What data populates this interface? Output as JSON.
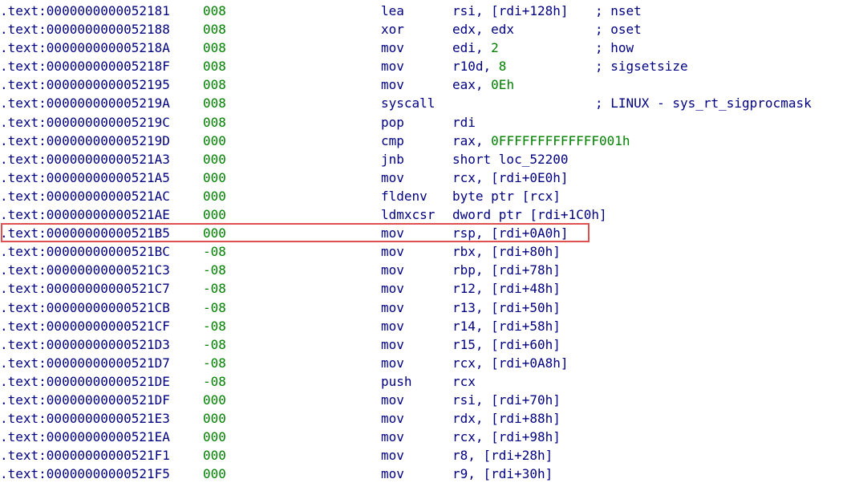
{
  "listing": {
    "highlight_color": "#e05050",
    "colors": {
      "text": "#000080",
      "stack_pointer": "#008000",
      "immediate": "#008000"
    },
    "highlighted_line_index": 12,
    "lines": [
      {
        "address": ".text:0000000000052181",
        "sp": "008",
        "mnemonic": "lea",
        "operands": [
          {
            "text": "rsi, [rdi+128h]",
            "kind": "reg"
          }
        ],
        "comment": "; nset"
      },
      {
        "address": ".text:0000000000052188",
        "sp": "008",
        "mnemonic": "xor",
        "operands": [
          {
            "text": "edx, edx",
            "kind": "reg"
          }
        ],
        "comment": "; oset"
      },
      {
        "address": ".text:000000000005218A",
        "sp": "008",
        "mnemonic": "mov",
        "operands": [
          {
            "text": "edi, ",
            "kind": "reg"
          },
          {
            "text": "2",
            "kind": "num"
          }
        ],
        "comment": "; how"
      },
      {
        "address": ".text:000000000005218F",
        "sp": "008",
        "mnemonic": "mov",
        "operands": [
          {
            "text": "r10d, ",
            "kind": "reg"
          },
          {
            "text": "8",
            "kind": "num"
          }
        ],
        "comment": "; sigsetsize"
      },
      {
        "address": ".text:0000000000052195",
        "sp": "008",
        "mnemonic": "mov",
        "operands": [
          {
            "text": "eax, ",
            "kind": "reg"
          },
          {
            "text": "0Eh",
            "kind": "num"
          }
        ],
        "comment": ""
      },
      {
        "address": ".text:000000000005219A",
        "sp": "008",
        "mnemonic": "syscall",
        "operands": [],
        "comment": "; LINUX - sys_rt_sigprocmask"
      },
      {
        "address": ".text:000000000005219C",
        "sp": "008",
        "mnemonic": "pop",
        "operands": [
          {
            "text": "rdi",
            "kind": "reg"
          }
        ],
        "comment": ""
      },
      {
        "address": ".text:000000000005219D",
        "sp": "000",
        "mnemonic": "cmp",
        "operands": [
          {
            "text": "rax, ",
            "kind": "reg"
          },
          {
            "text": "0FFFFFFFFFFFFF001h",
            "kind": "num"
          }
        ],
        "comment": ""
      },
      {
        "address": ".text:00000000000521A3",
        "sp": "000",
        "mnemonic": "jnb",
        "operands": [
          {
            "text": "short loc_52200",
            "kind": "reg"
          }
        ],
        "comment": ""
      },
      {
        "address": ".text:00000000000521A5",
        "sp": "000",
        "mnemonic": "mov",
        "operands": [
          {
            "text": "rcx, [rdi+0E0h]",
            "kind": "reg"
          }
        ],
        "comment": ""
      },
      {
        "address": ".text:00000000000521AC",
        "sp": "000",
        "mnemonic": "fldenv",
        "operands": [
          {
            "text": "byte ptr [rcx]",
            "kind": "reg"
          }
        ],
        "comment": ""
      },
      {
        "address": ".text:00000000000521AE",
        "sp": "000",
        "mnemonic": "ldmxcsr",
        "operands": [
          {
            "text": "dword ptr [rdi+1C0h]",
            "kind": "reg"
          }
        ],
        "comment": ""
      },
      {
        "address": ".text:00000000000521B5",
        "sp": "000",
        "mnemonic": "mov",
        "operands": [
          {
            "text": "rsp, [rdi+0A0h]",
            "kind": "reg"
          }
        ],
        "comment": ""
      },
      {
        "address": ".text:00000000000521BC",
        "sp": "-08",
        "mnemonic": "mov",
        "operands": [
          {
            "text": "rbx, [rdi+80h]",
            "kind": "reg"
          }
        ],
        "comment": ""
      },
      {
        "address": ".text:00000000000521C3",
        "sp": "-08",
        "mnemonic": "mov",
        "operands": [
          {
            "text": "rbp, [rdi+78h]",
            "kind": "reg"
          }
        ],
        "comment": ""
      },
      {
        "address": ".text:00000000000521C7",
        "sp": "-08",
        "mnemonic": "mov",
        "operands": [
          {
            "text": "r12, [rdi+48h]",
            "kind": "reg"
          }
        ],
        "comment": ""
      },
      {
        "address": ".text:00000000000521CB",
        "sp": "-08",
        "mnemonic": "mov",
        "operands": [
          {
            "text": "r13, [rdi+50h]",
            "kind": "reg"
          }
        ],
        "comment": ""
      },
      {
        "address": ".text:00000000000521CF",
        "sp": "-08",
        "mnemonic": "mov",
        "operands": [
          {
            "text": "r14, [rdi+58h]",
            "kind": "reg"
          }
        ],
        "comment": ""
      },
      {
        "address": ".text:00000000000521D3",
        "sp": "-08",
        "mnemonic": "mov",
        "operands": [
          {
            "text": "r15, [rdi+60h]",
            "kind": "reg"
          }
        ],
        "comment": ""
      },
      {
        "address": ".text:00000000000521D7",
        "sp": "-08",
        "mnemonic": "mov",
        "operands": [
          {
            "text": "rcx, [rdi+0A8h]",
            "kind": "reg"
          }
        ],
        "comment": ""
      },
      {
        "address": ".text:00000000000521DE",
        "sp": "-08",
        "mnemonic": "push",
        "operands": [
          {
            "text": "rcx",
            "kind": "reg"
          }
        ],
        "comment": ""
      },
      {
        "address": ".text:00000000000521DF",
        "sp": "000",
        "mnemonic": "mov",
        "operands": [
          {
            "text": "rsi, [rdi+70h]",
            "kind": "reg"
          }
        ],
        "comment": ""
      },
      {
        "address": ".text:00000000000521E3",
        "sp": "000",
        "mnemonic": "mov",
        "operands": [
          {
            "text": "rdx, [rdi+88h]",
            "kind": "reg"
          }
        ],
        "comment": ""
      },
      {
        "address": ".text:00000000000521EA",
        "sp": "000",
        "mnemonic": "mov",
        "operands": [
          {
            "text": "rcx, [rdi+98h]",
            "kind": "reg"
          }
        ],
        "comment": ""
      },
      {
        "address": ".text:00000000000521F1",
        "sp": "000",
        "mnemonic": "mov",
        "operands": [
          {
            "text": "r8, [rdi+28h]",
            "kind": "reg"
          }
        ],
        "comment": ""
      },
      {
        "address": ".text:00000000000521F5",
        "sp": "000",
        "mnemonic": "mov",
        "operands": [
          {
            "text": "r9, [rdi+30h]",
            "kind": "reg"
          }
        ],
        "comment": ""
      }
    ]
  }
}
